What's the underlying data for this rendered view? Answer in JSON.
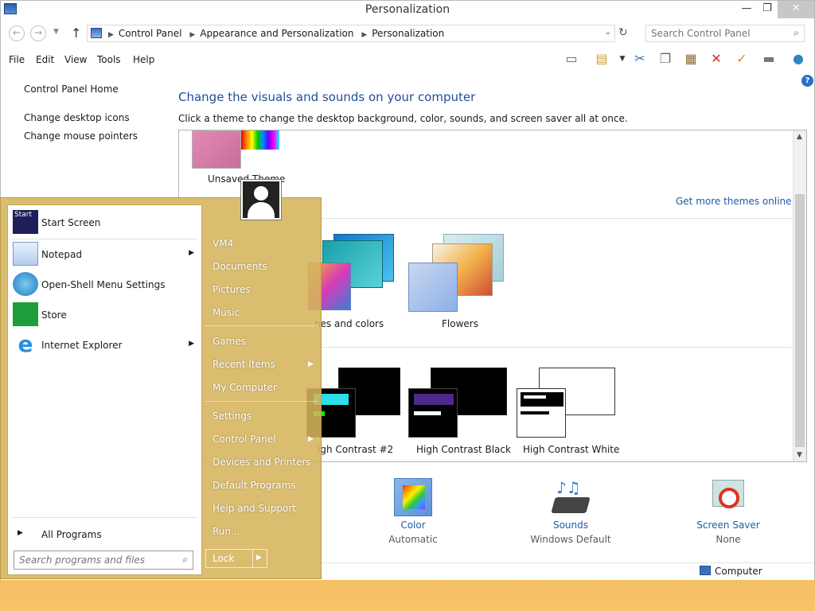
{
  "window": {
    "title": "Personalization"
  },
  "nav": {
    "breadcrumbs": [
      "Control Panel",
      "Appearance and Personalization",
      "Personalization"
    ],
    "search_placeholder": "Search Control Panel"
  },
  "menu": [
    "File",
    "Edit",
    "View",
    "Tools",
    "Help"
  ],
  "sidebar": {
    "home": "Control Panel Home",
    "links": [
      "Change desktop icons",
      "Change mouse pointers"
    ]
  },
  "main": {
    "heading": "Change the visuals and sounds on your computer",
    "subheading": "Click a theme to change the desktop background, color, sounds, and screen saver all at once.",
    "get_more": "Get more themes online",
    "themes_row1": [
      "Unsaved Theme"
    ],
    "themes_row2": [
      "nes and colors",
      "Flowers"
    ],
    "themes_row3": [
      "igh Contrast #2",
      "High Contrast Black",
      "High Contrast White"
    ]
  },
  "bottom": [
    {
      "label": "Color",
      "sub": "Automatic"
    },
    {
      "label": "Sounds",
      "sub": "Windows Default"
    },
    {
      "label": "Screen Saver",
      "sub": "None"
    }
  ],
  "status": {
    "computer": "Computer"
  },
  "startmenu": {
    "left_items": [
      "Start Screen",
      "Notepad",
      "Open-Shell Menu Settings",
      "Store",
      "Internet Explorer"
    ],
    "all_programs": "All Programs",
    "search_placeholder": "Search programs and files",
    "right_items": [
      "VM4",
      "Documents",
      "Pictures",
      "Music",
      "Games",
      "Recent Items",
      "My Computer",
      "Settings",
      "Control Panel",
      "Devices and Printers",
      "Default Programs",
      "Help and Support",
      "Run..."
    ],
    "lock": "Lock",
    "start_icon_text": "Start"
  }
}
